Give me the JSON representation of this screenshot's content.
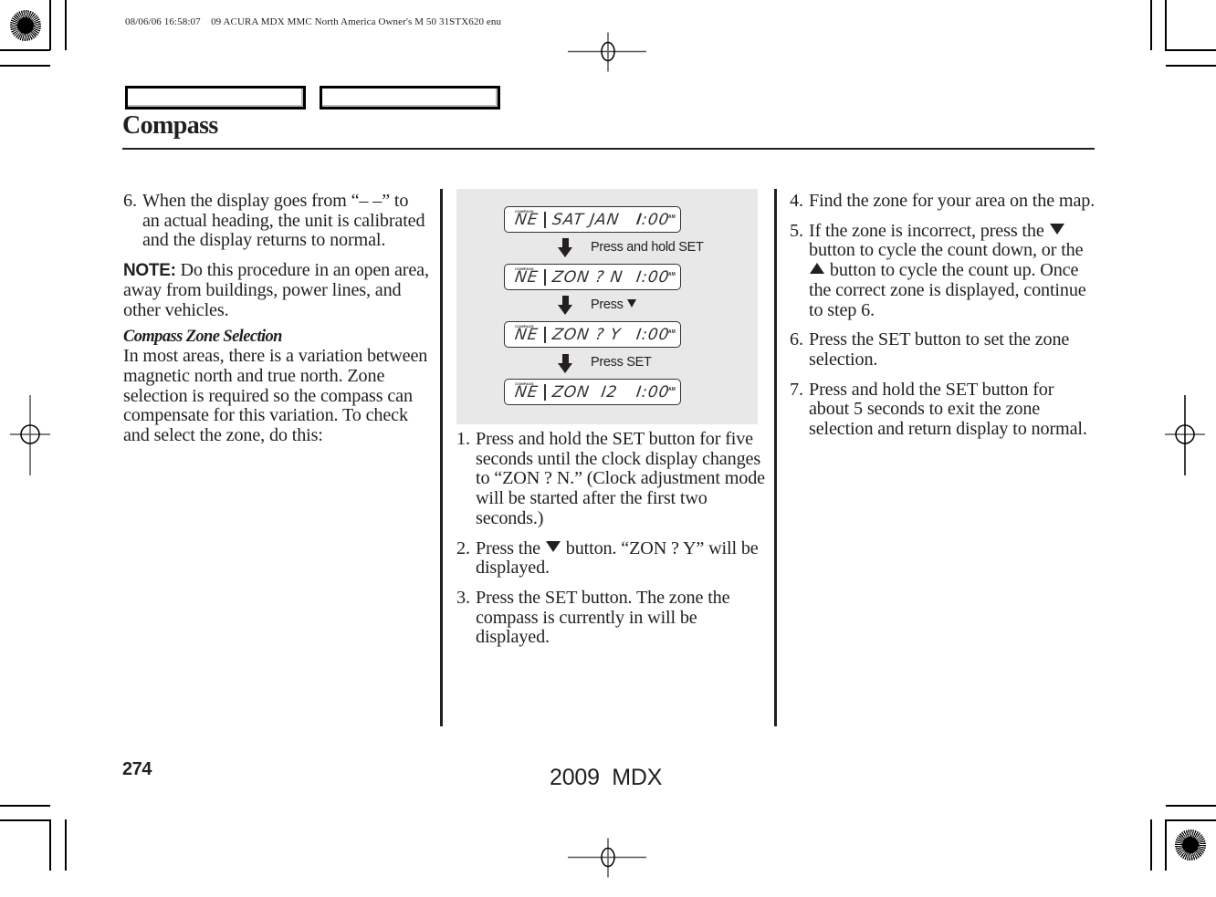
{
  "print_slug": "08/06/06 16:58:07    09 ACURA MDX MMC North America Owner's M 50 31STX620 enu",
  "header": {
    "tabs": [
      {
        "label": ""
      },
      {
        "label": ""
      }
    ],
    "title": "Compass"
  },
  "left_column": {
    "step6": {
      "num": "6.",
      "text": "When the display goes from “– –” to an actual heading, the unit is calibrated and the display returns to normal."
    },
    "note": {
      "label": "NOTE:",
      "text": " Do this procedure in an open area, away from buildings, power lines, and other vehicles."
    },
    "subheading": "Compass Zone Selection",
    "intro": "In most areas, there is a variation between magnetic north and true north. Zone selection is required so the compass can compensate for this variation. To check and select the zone, do this:"
  },
  "illustration": {
    "compass_label": "COMPASS",
    "displays": [
      {
        "heading": "NE",
        "message": "SAT JAN   I",
        "clock": "I:00",
        "ampm": "AM"
      },
      {
        "heading": "NE",
        "message": "ZON ? N",
        "clock": "I:00",
        "ampm": "AM"
      },
      {
        "heading": "NE",
        "message": "ZON ? Y",
        "clock": "I:00",
        "ampm": "AM"
      },
      {
        "heading": "NE",
        "message": "ZON  I2",
        "clock": "I:00",
        "ampm": "AM"
      }
    ],
    "transitions": [
      {
        "text": "Press and hold SET",
        "icon": ""
      },
      {
        "text": "Press ",
        "icon": "down-triangle"
      },
      {
        "text": "Press SET",
        "icon": ""
      }
    ]
  },
  "middle_column": {
    "steps": [
      {
        "num": "1.",
        "text": "Press and hold the SET button for five seconds until the clock display changes to “ZON ? N.” (Clock adjustment mode will be started after the first two seconds.)"
      },
      {
        "num": "2.",
        "text_before": "Press the ",
        "icon": "down-triangle",
        "text_after": " button. “ZON ? Y” will be displayed."
      },
      {
        "num": "3.",
        "text": "Press the SET button. The zone the compass is currently in will be displayed."
      }
    ]
  },
  "right_column": {
    "steps": [
      {
        "num": "4.",
        "text": "Find the zone for your area on the map."
      },
      {
        "num": "5.",
        "text_a": "If the zone is incorrect, press the ",
        "icon_a": "down-triangle",
        "text_b": " button to cycle the count down, or the ",
        "icon_b": "up-triangle",
        "text_c": " button to cycle the count up. Once the correct zone is displayed, continue to step 6."
      },
      {
        "num": "6.",
        "text": "Press the SET button to set the zone selection."
      },
      {
        "num": "7.",
        "text": "Press and hold the SET button for about 5 seconds to exit the zone selection and return display to normal."
      }
    ]
  },
  "footer": {
    "page_number": "274",
    "model": "2009  MDX"
  },
  "colors": {
    "text": "#231f20",
    "illustration_bg": "#e8e8e8"
  }
}
